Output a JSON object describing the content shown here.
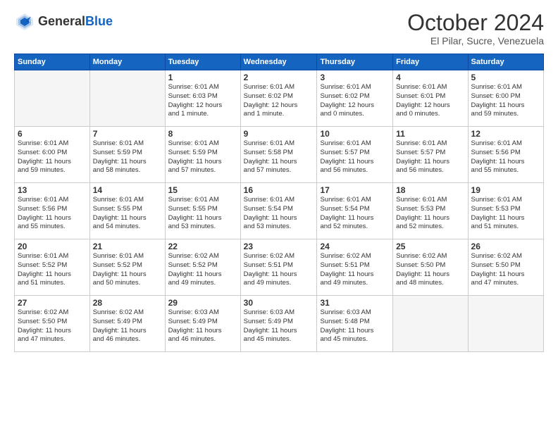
{
  "header": {
    "logo_general": "General",
    "logo_blue": "Blue",
    "month": "October 2024",
    "location": "El Pilar, Sucre, Venezuela"
  },
  "days_of_week": [
    "Sunday",
    "Monday",
    "Tuesday",
    "Wednesday",
    "Thursday",
    "Friday",
    "Saturday"
  ],
  "weeks": [
    [
      {
        "day": "",
        "info": ""
      },
      {
        "day": "",
        "info": ""
      },
      {
        "day": "1",
        "info": "Sunrise: 6:01 AM\nSunset: 6:03 PM\nDaylight: 12 hours\nand 1 minute."
      },
      {
        "day": "2",
        "info": "Sunrise: 6:01 AM\nSunset: 6:02 PM\nDaylight: 12 hours\nand 1 minute."
      },
      {
        "day": "3",
        "info": "Sunrise: 6:01 AM\nSunset: 6:02 PM\nDaylight: 12 hours\nand 0 minutes."
      },
      {
        "day": "4",
        "info": "Sunrise: 6:01 AM\nSunset: 6:01 PM\nDaylight: 12 hours\nand 0 minutes."
      },
      {
        "day": "5",
        "info": "Sunrise: 6:01 AM\nSunset: 6:00 PM\nDaylight: 11 hours\nand 59 minutes."
      }
    ],
    [
      {
        "day": "6",
        "info": "Sunrise: 6:01 AM\nSunset: 6:00 PM\nDaylight: 11 hours\nand 59 minutes."
      },
      {
        "day": "7",
        "info": "Sunrise: 6:01 AM\nSunset: 5:59 PM\nDaylight: 11 hours\nand 58 minutes."
      },
      {
        "day": "8",
        "info": "Sunrise: 6:01 AM\nSunset: 5:59 PM\nDaylight: 11 hours\nand 57 minutes."
      },
      {
        "day": "9",
        "info": "Sunrise: 6:01 AM\nSunset: 5:58 PM\nDaylight: 11 hours\nand 57 minutes."
      },
      {
        "day": "10",
        "info": "Sunrise: 6:01 AM\nSunset: 5:57 PM\nDaylight: 11 hours\nand 56 minutes."
      },
      {
        "day": "11",
        "info": "Sunrise: 6:01 AM\nSunset: 5:57 PM\nDaylight: 11 hours\nand 56 minutes."
      },
      {
        "day": "12",
        "info": "Sunrise: 6:01 AM\nSunset: 5:56 PM\nDaylight: 11 hours\nand 55 minutes."
      }
    ],
    [
      {
        "day": "13",
        "info": "Sunrise: 6:01 AM\nSunset: 5:56 PM\nDaylight: 11 hours\nand 55 minutes."
      },
      {
        "day": "14",
        "info": "Sunrise: 6:01 AM\nSunset: 5:55 PM\nDaylight: 11 hours\nand 54 minutes."
      },
      {
        "day": "15",
        "info": "Sunrise: 6:01 AM\nSunset: 5:55 PM\nDaylight: 11 hours\nand 53 minutes."
      },
      {
        "day": "16",
        "info": "Sunrise: 6:01 AM\nSunset: 5:54 PM\nDaylight: 11 hours\nand 53 minutes."
      },
      {
        "day": "17",
        "info": "Sunrise: 6:01 AM\nSunset: 5:54 PM\nDaylight: 11 hours\nand 52 minutes."
      },
      {
        "day": "18",
        "info": "Sunrise: 6:01 AM\nSunset: 5:53 PM\nDaylight: 11 hours\nand 52 minutes."
      },
      {
        "day": "19",
        "info": "Sunrise: 6:01 AM\nSunset: 5:53 PM\nDaylight: 11 hours\nand 51 minutes."
      }
    ],
    [
      {
        "day": "20",
        "info": "Sunrise: 6:01 AM\nSunset: 5:52 PM\nDaylight: 11 hours\nand 51 minutes."
      },
      {
        "day": "21",
        "info": "Sunrise: 6:01 AM\nSunset: 5:52 PM\nDaylight: 11 hours\nand 50 minutes."
      },
      {
        "day": "22",
        "info": "Sunrise: 6:02 AM\nSunset: 5:52 PM\nDaylight: 11 hours\nand 49 minutes."
      },
      {
        "day": "23",
        "info": "Sunrise: 6:02 AM\nSunset: 5:51 PM\nDaylight: 11 hours\nand 49 minutes."
      },
      {
        "day": "24",
        "info": "Sunrise: 6:02 AM\nSunset: 5:51 PM\nDaylight: 11 hours\nand 49 minutes."
      },
      {
        "day": "25",
        "info": "Sunrise: 6:02 AM\nSunset: 5:50 PM\nDaylight: 11 hours\nand 48 minutes."
      },
      {
        "day": "26",
        "info": "Sunrise: 6:02 AM\nSunset: 5:50 PM\nDaylight: 11 hours\nand 47 minutes."
      }
    ],
    [
      {
        "day": "27",
        "info": "Sunrise: 6:02 AM\nSunset: 5:50 PM\nDaylight: 11 hours\nand 47 minutes."
      },
      {
        "day": "28",
        "info": "Sunrise: 6:02 AM\nSunset: 5:49 PM\nDaylight: 11 hours\nand 46 minutes."
      },
      {
        "day": "29",
        "info": "Sunrise: 6:03 AM\nSunset: 5:49 PM\nDaylight: 11 hours\nand 46 minutes."
      },
      {
        "day": "30",
        "info": "Sunrise: 6:03 AM\nSunset: 5:49 PM\nDaylight: 11 hours\nand 45 minutes."
      },
      {
        "day": "31",
        "info": "Sunrise: 6:03 AM\nSunset: 5:48 PM\nDaylight: 11 hours\nand 45 minutes."
      },
      {
        "day": "",
        "info": ""
      },
      {
        "day": "",
        "info": ""
      }
    ]
  ]
}
